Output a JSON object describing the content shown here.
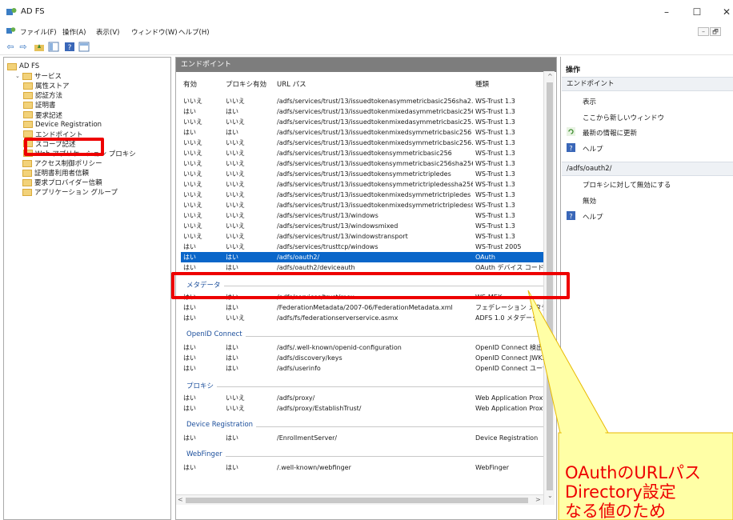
{
  "window": {
    "title": "AD FS",
    "minimize": "–",
    "maximize": "☐",
    "close": "✕"
  },
  "menu": [
    "ファイル(F)",
    "操作(A)",
    "表示(V)",
    "ウィンドウ(W)",
    "ヘルプ(H)"
  ],
  "mdi": {
    "minimize": "–",
    "restore": "🗗"
  },
  "toolbar": {
    "back": "⇦",
    "forward": "⇨"
  },
  "tree": [
    {
      "label": "AD FS",
      "indent": 0,
      "caret": ""
    },
    {
      "label": "サービス",
      "indent": 1,
      "caret": "⌄"
    },
    {
      "label": "属性ストア",
      "indent": 2,
      "caret": ""
    },
    {
      "label": "認証方法",
      "indent": 2,
      "caret": ""
    },
    {
      "label": "証明書",
      "indent": 2,
      "caret": ""
    },
    {
      "label": "要求記述",
      "indent": 2,
      "caret": ""
    },
    {
      "label": "Device Registration",
      "indent": 2,
      "caret": ""
    },
    {
      "label": "エンドポイント",
      "indent": 2,
      "caret": ""
    },
    {
      "label": "スコープ記述",
      "indent": 2,
      "caret": ""
    },
    {
      "label": "Web アプリケーション プロキシ",
      "indent": 2,
      "caret": ""
    },
    {
      "label": "アクセス制御ポリシー",
      "indent": 1,
      "caret": ""
    },
    {
      "label": "証明書利用者信頼",
      "indent": 1,
      "caret": ""
    },
    {
      "label": "要求プロバイダー信頼",
      "indent": 1,
      "caret": ""
    },
    {
      "label": "アプリケーション グループ",
      "indent": 1,
      "caret": ""
    }
  ],
  "center": {
    "header": "エンドポイント",
    "columns": [
      "有効",
      "プロキシ有効",
      "URL パス",
      "種類"
    ],
    "groups": [
      {
        "title": "",
        "rows": [
          [
            "いいえ",
            "いいえ",
            "/adfs/services/trust/13/issuedtokenasymmetricbasic256sha2...",
            "WS-Trust 1.3"
          ],
          [
            "はい",
            "はい",
            "/adfs/services/trust/13/issuedtokenmixedasymmetricbasic256",
            "WS-Trust 1.3"
          ],
          [
            "いいえ",
            "いいえ",
            "/adfs/services/trust/13/issuedtokenmixedasymmetricbasic25...",
            "WS-Trust 1.3"
          ],
          [
            "はい",
            "はい",
            "/adfs/services/trust/13/issuedtokenmixedsymmetricbasic256",
            "WS-Trust 1.3"
          ],
          [
            "いいえ",
            "いいえ",
            "/adfs/services/trust/13/issuedtokenmixedsymmetricbasic256...",
            "WS-Trust 1.3"
          ],
          [
            "いいえ",
            "いいえ",
            "/adfs/services/trust/13/issuedtokensymmetricbasic256",
            "WS-Trust 1.3"
          ],
          [
            "いいえ",
            "いいえ",
            "/adfs/services/trust/13/issuedtokensymmetricbasic256sha256",
            "WS-Trust 1.3"
          ],
          [
            "いいえ",
            "いいえ",
            "/adfs/services/trust/13/issuedtokensymmetrictripledes",
            "WS-Trust 1.3"
          ],
          [
            "いいえ",
            "いいえ",
            "/adfs/services/trust/13/issuedtokensymmetrictripledessha256",
            "WS-Trust 1.3"
          ],
          [
            "いいえ",
            "いいえ",
            "/adfs/services/trust/13/issuedtokenmixedsymmetrictripledes",
            "WS-Trust 1.3"
          ],
          [
            "いいえ",
            "いいえ",
            "/adfs/services/trust/13/issuedtokenmixedsymmetrictripledess...",
            "WS-Trust 1.3"
          ],
          [
            "いいえ",
            "いいえ",
            "/adfs/services/trust/13/windows",
            "WS-Trust 1.3"
          ],
          [
            "いいえ",
            "いいえ",
            "/adfs/services/trust/13/windowsmixed",
            "WS-Trust 1.3"
          ],
          [
            "いいえ",
            "いいえ",
            "/adfs/services/trust/13/windowstransport",
            "WS-Trust 1.3"
          ],
          [
            "はい",
            "いいえ",
            "/adfs/services/trusttcp/windows",
            "WS-Trust 2005"
          ],
          [
            "はい",
            "はい",
            "/adfs/oauth2/",
            "OAuth"
          ],
          [
            "はい",
            "はい",
            "/adfs/oauth2/deviceauth",
            "OAuth デバイス コード"
          ]
        ]
      },
      {
        "title": "メタデータ",
        "rows": [
          [
            "はい",
            "はい",
            "/adfs/services/trust/mex",
            "WS-MEX"
          ],
          [
            "はい",
            "はい",
            "/FederationMetadata/2007-06/FederationMetadata.xml",
            "フェデレーション メタデータ"
          ],
          [
            "はい",
            "いいえ",
            "/adfs/fs/federationserverservice.asmx",
            "ADFS 1.0 メタデータ"
          ]
        ]
      },
      {
        "title": "OpenID Connect",
        "rows": [
          [
            "はい",
            "はい",
            "/adfs/.well-known/openid-configuration",
            "OpenID Connect 検出"
          ],
          [
            "はい",
            "はい",
            "/adfs/discovery/keys",
            "OpenID Connect JWKS"
          ],
          [
            "はい",
            "はい",
            "/adfs/userinfo",
            "OpenID Connect ユーザー情報"
          ]
        ]
      },
      {
        "title": "プロキシ",
        "rows": [
          [
            "はい",
            "いいえ",
            "/adfs/proxy/",
            "Web Application Proxy"
          ],
          [
            "はい",
            "いいえ",
            "/adfs/proxy/EstablishTrust/",
            "Web Application Proxy"
          ]
        ]
      },
      {
        "title": "Device Registration",
        "rows": [
          [
            "はい",
            "はい",
            "/EnrollmentServer/",
            "Device Registration"
          ]
        ]
      },
      {
        "title": "WebFinger",
        "rows": [
          [
            "はい",
            "はい",
            "/.well-known/webfinger",
            "WebFinger"
          ]
        ]
      }
    ],
    "selected_path": "/adfs/oauth2/"
  },
  "actions": {
    "title": "操作",
    "section1": "エンドポイント",
    "section1_items": [
      "表示",
      "ここから新しいウィンドウ",
      "最新の情報に更新",
      "ヘルプ"
    ],
    "section2": "/adfs/oauth2/",
    "section2_items": [
      "プロキシに対して無効にする",
      "無効",
      "ヘルプ"
    ]
  },
  "callout": {
    "lines": [
      "OAuthのURLパス",
      "Directory設定",
      "なる値のため"
    ]
  }
}
